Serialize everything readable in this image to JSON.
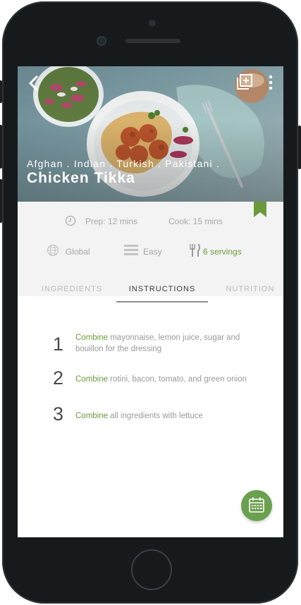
{
  "recipe": {
    "cuisines": "Afghan . Indian . Turkish . Pakistani .",
    "title": "Chicken Tikka"
  },
  "meta": {
    "prep": "Prep: 12 mins",
    "cook": "Cook: 15 mins",
    "region": "Global",
    "difficulty": "Easy",
    "servings": "6 servings"
  },
  "tabs": [
    {
      "label": "INGREDIENTS"
    },
    {
      "label": "INSTRUCTIONS"
    },
    {
      "label": "NUTRITION"
    }
  ],
  "steps": [
    {
      "number": "1",
      "verb": "Combine",
      "text": " mayonnaise, lemon juice, sugar and bouillon for the dressing"
    },
    {
      "number": "2",
      "verb": "Combine",
      "text": " rotini, bacon, tomato, and green onion"
    },
    {
      "number": "3",
      "verb": "Combine",
      "text": " all ingredients with lettuce"
    }
  ],
  "icons": {
    "back": "chevron-left-icon",
    "add": "add-to-collection-icon",
    "more": "more-vertical-icon",
    "bookmark": "bookmark-icon",
    "clock": "clock-icon",
    "globe": "globe-icon",
    "difficulty": "difficulty-icon",
    "servings": "fork-knife-icon",
    "calendar": "calendar-icon"
  },
  "colors": {
    "accent": "#6b9a3c",
    "fab": "#6ba04e",
    "phone_frame": "#161a1d"
  }
}
